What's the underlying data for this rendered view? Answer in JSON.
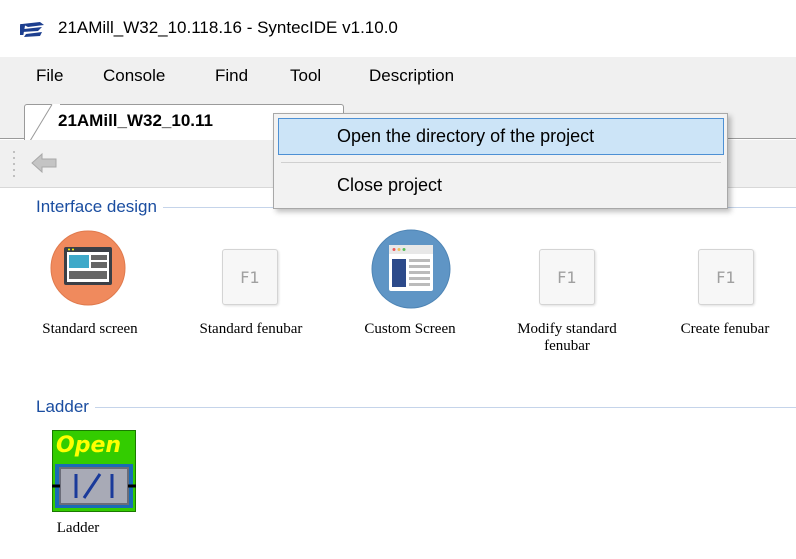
{
  "window": {
    "title": "21AMill_W32_10.118.16 - SyntecIDE v1.10.0",
    "icon": "syntec-logo-icon"
  },
  "menu": {
    "items": [
      "File",
      "Console",
      "Find",
      "Tool",
      "Description"
    ]
  },
  "tabs": {
    "project_tab_label": "21AMill_W32_10.11"
  },
  "toolbar": {
    "back_icon": "back-arrow-icon"
  },
  "sections": {
    "interface_design": {
      "title": "Interface design",
      "items": [
        {
          "label": "Standard screen",
          "icon": "standard-screen-icon"
        },
        {
          "label": "Standard fenubar",
          "icon": "f1-key-icon",
          "key": "F1"
        },
        {
          "label": "Custom Screen",
          "icon": "custom-screen-icon"
        },
        {
          "label": "Modify standard fenubar",
          "line1": "Modify standard",
          "line2": "fenubar",
          "icon": "f1-key-icon",
          "key": "F1"
        },
        {
          "label": "Create fenubar",
          "icon": "f1-key-icon",
          "key": "F1"
        }
      ]
    },
    "ladder": {
      "title": "Ladder",
      "items": [
        {
          "label": "Ladder",
          "icon": "ladder-icon",
          "icon_text": "Open"
        }
      ]
    }
  },
  "context_menu": {
    "items": [
      "Open the directory of the project",
      "Close project"
    ]
  },
  "colors": {
    "section_title": "#1a4da0",
    "menu_highlight": "#cce4f7",
    "menu_highlight_border": "#4d90d4",
    "ladder_green": "#33cc00",
    "ladder_text": "#ffff00"
  }
}
